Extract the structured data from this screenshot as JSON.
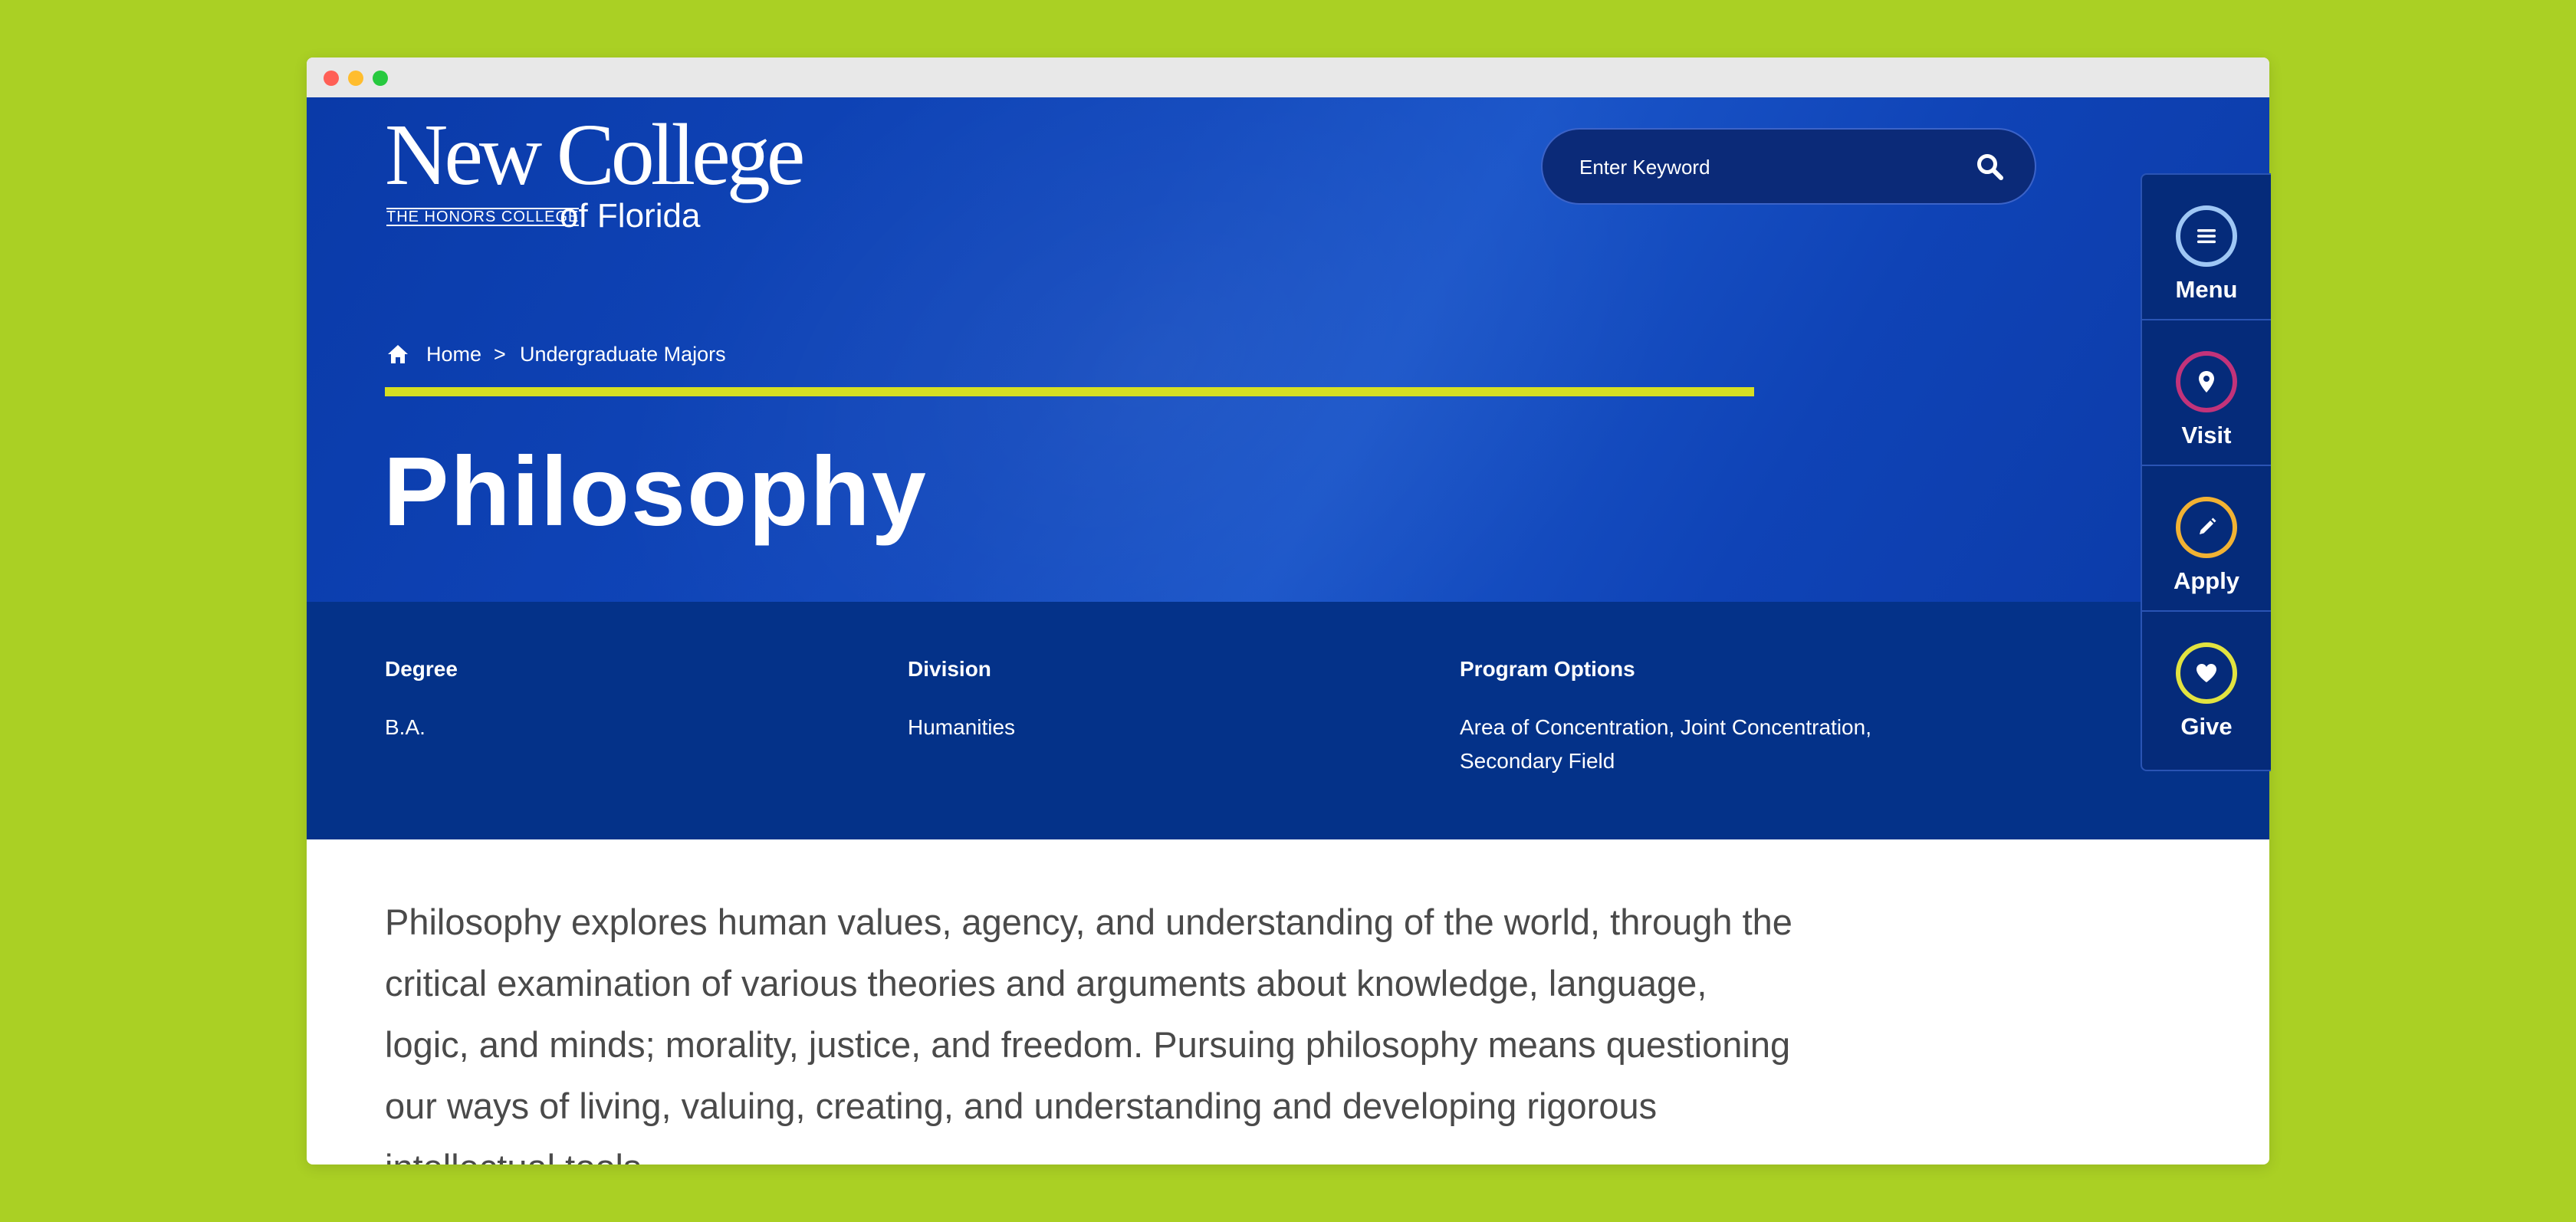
{
  "logo": {
    "main": "New College",
    "tagline": "THE HONORS COLLEGE",
    "suffix": "of Florida"
  },
  "search": {
    "placeholder": "Enter Keyword"
  },
  "breadcrumb": {
    "home": "Home",
    "separator": ">",
    "current": "Undergraduate Majors"
  },
  "page": {
    "title": "Philosophy"
  },
  "program_info": [
    {
      "heading": "Degree",
      "value": "B.A."
    },
    {
      "heading": "Division",
      "value": "Humanities"
    },
    {
      "heading": "Program Options",
      "value": "Area of Concentration, Joint Concentration, Secondary Field"
    }
  ],
  "intro": "Philosophy explores human values, agency, and understanding of the world, through the critical examination of various theories and arguments about knowledge, language, logic, and minds; morality, justice, and freedom. Pursuing philosophy means questioning our ways of living, valuing, creating, and understanding and developing rigorous intellectual tools.",
  "side_nav": [
    {
      "label": "Menu",
      "icon": "menu-icon",
      "color": "#9fc7f5"
    },
    {
      "label": "Visit",
      "icon": "location-pin-icon",
      "color": "#c2337a"
    },
    {
      "label": "Apply",
      "icon": "pencil-icon",
      "color": "#f2b233"
    },
    {
      "label": "Give",
      "icon": "heart-icon",
      "color": "#e2e340"
    }
  ],
  "colors": {
    "background": "#aad024",
    "hero_blue": "#1148bd",
    "info_band": "#043289",
    "accent": "#d6df22"
  }
}
